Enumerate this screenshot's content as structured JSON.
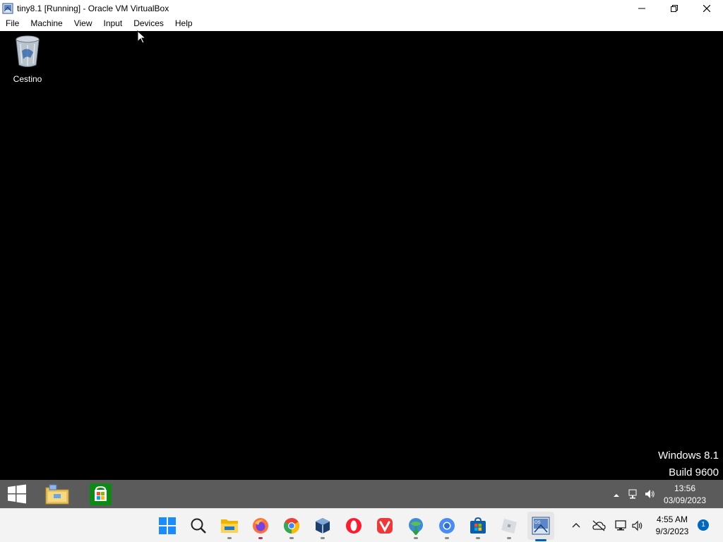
{
  "window": {
    "title": "tiny8.1 [Running] - Oracle VM VirtualBox",
    "controls": [
      "minimize",
      "restore",
      "close"
    ]
  },
  "menu": [
    "File",
    "Machine",
    "View",
    "Input",
    "Devices",
    "Help"
  ],
  "desktop": {
    "icons": [
      {
        "label": "Cestino",
        "icon": "recycle-bin-icon"
      }
    ],
    "watermark": {
      "line1": "Windows 8.1",
      "line2": "Build 9600"
    }
  },
  "guest_taskbar": {
    "pinned": [
      "start-button",
      "file-explorer",
      "store"
    ],
    "time": "13:56",
    "date": "03/09/2023"
  },
  "host_taskbar": {
    "apps": [
      "start",
      "search",
      "file-explorer",
      "firefox",
      "chrome",
      "virtualbox-cube",
      "opera",
      "vivaldi",
      "internet-download-manager",
      "chromium",
      "microsoft-store",
      "roblox",
      "virtualbox-vm"
    ],
    "time": "4:55 AM",
    "date": "9/3/2023",
    "notification_count": "1"
  },
  "colors": {
    "guest_taskbar": "#5b5b5b",
    "host_taskbar": "#f3f3f3",
    "accent": "#005fb8"
  }
}
